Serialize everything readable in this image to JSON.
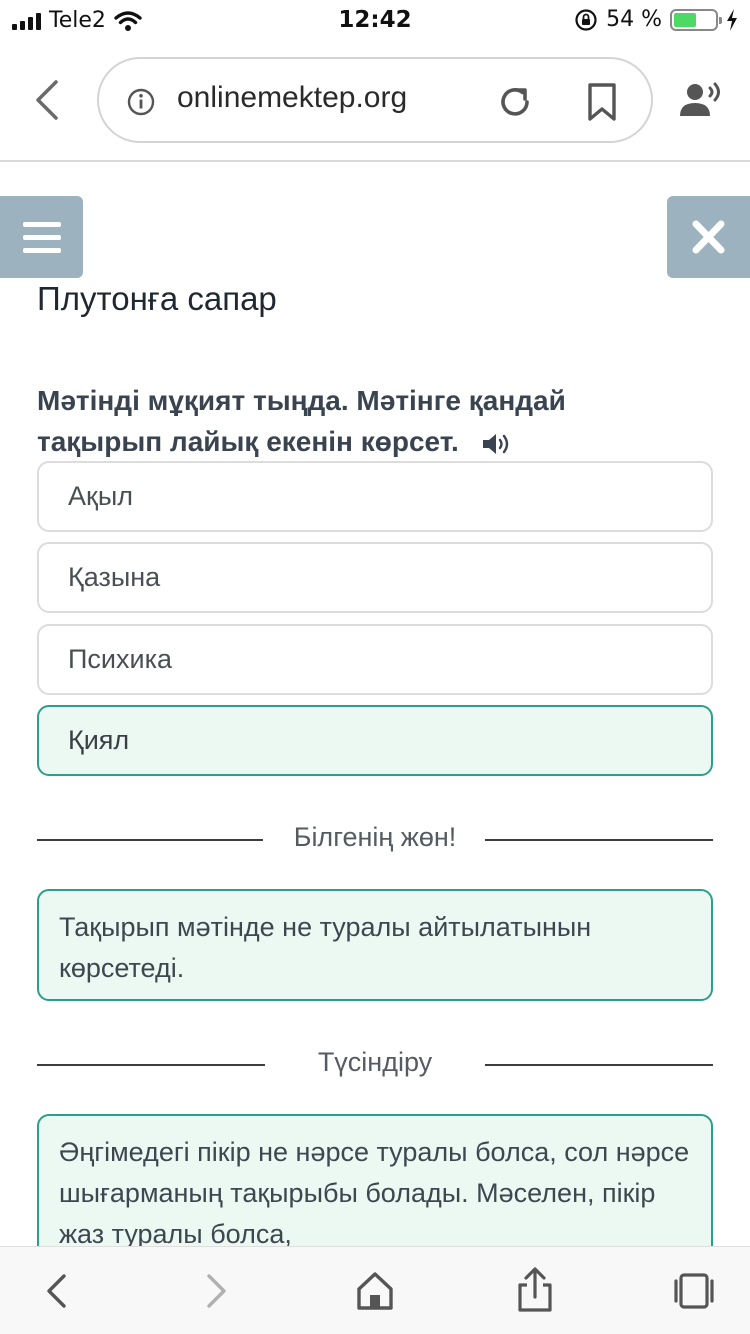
{
  "status_bar": {
    "carrier": "Tele2",
    "time": "12:42",
    "battery_percent": "54 %",
    "battery_level": 0.54
  },
  "browser": {
    "url": "onlinemektep.org",
    "icons": [
      "back-icon",
      "info-icon",
      "reload-icon",
      "bookmark-icon",
      "voice-user-icon"
    ]
  },
  "page": {
    "title": "Плутонға сапар",
    "question": "Мәтінді мұқият тыңда. Мәтінге қандай тақырып лайық екенін көрсет.",
    "options": [
      {
        "label": "Ақыл",
        "correct": false
      },
      {
        "label": "Қазына",
        "correct": false
      },
      {
        "label": "Психика",
        "correct": false
      },
      {
        "label": "Қиял",
        "correct": true
      }
    ],
    "know_heading": "Білгенің жөн!",
    "know_text": "Тақырып мәтінде не туралы айтылатынын көрсетеді.",
    "explain_heading": "Түсіндіру",
    "explain_text": "Әңгімедегі пікір не нәрсе туралы болса, сол нәрсе шығарманың тақырыбы болады. Мәселен, пікір жаз туралы болса,"
  },
  "colors": {
    "accent": "#2aa08a",
    "correct_bg": "#ecf9f3",
    "side_button": "#9cb3bf",
    "battery": "#4cd964"
  }
}
